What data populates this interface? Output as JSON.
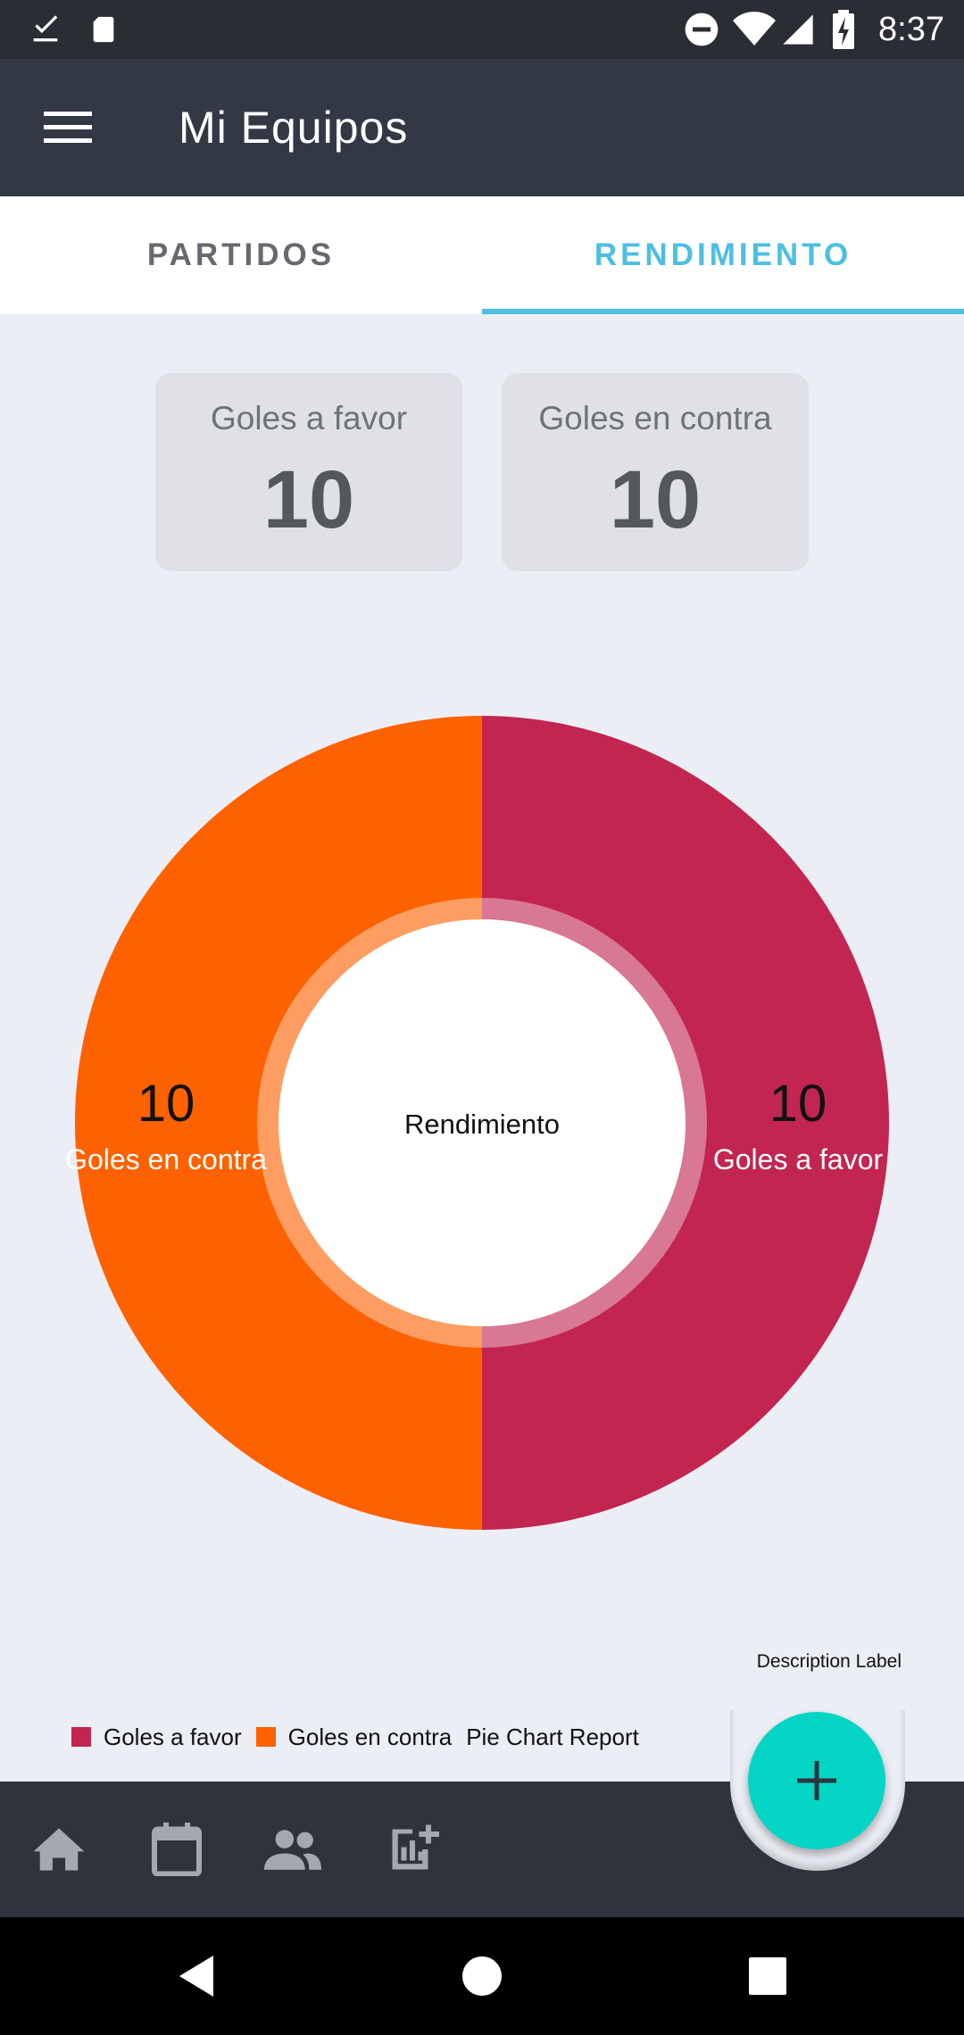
{
  "status_bar": {
    "time": "8:37",
    "icons": [
      "download-done-icon",
      "sd-card-icon",
      "do-not-disturb-icon",
      "wifi-icon",
      "signal-icon",
      "battery-charging-icon"
    ]
  },
  "app_bar": {
    "title": "Mi Equipos",
    "menu_icon": "hamburger-menu-icon"
  },
  "tabs": [
    {
      "label": "PARTIDOS",
      "selected": false
    },
    {
      "label": "RENDIMIENTO",
      "selected": true
    }
  ],
  "stats": {
    "goles_a_favor": {
      "label": "Goles a favor",
      "value": "10"
    },
    "goles_en_contra": {
      "label": "Goles en contra",
      "value": "10"
    }
  },
  "chart_data": {
    "type": "pie",
    "center_text": "Rendimiento",
    "description": "Description Label",
    "legend_title": "Pie Chart Report",
    "slices": [
      {
        "label": "Goles a favor",
        "value": 10,
        "color": "#c22550"
      },
      {
        "label": "Goles en contra",
        "value": 10,
        "color": "#fe6100"
      }
    ]
  },
  "bottom_nav": {
    "items": [
      "home-icon",
      "calendar-icon",
      "people-icon",
      "add-chart-icon"
    ],
    "fab_icon": "plus-icon"
  },
  "colors": {
    "accent": "#4cbfe3",
    "app_bar": "#333845",
    "fab": "#04d5c5",
    "favor": "#c22550",
    "contra": "#fe6100"
  }
}
